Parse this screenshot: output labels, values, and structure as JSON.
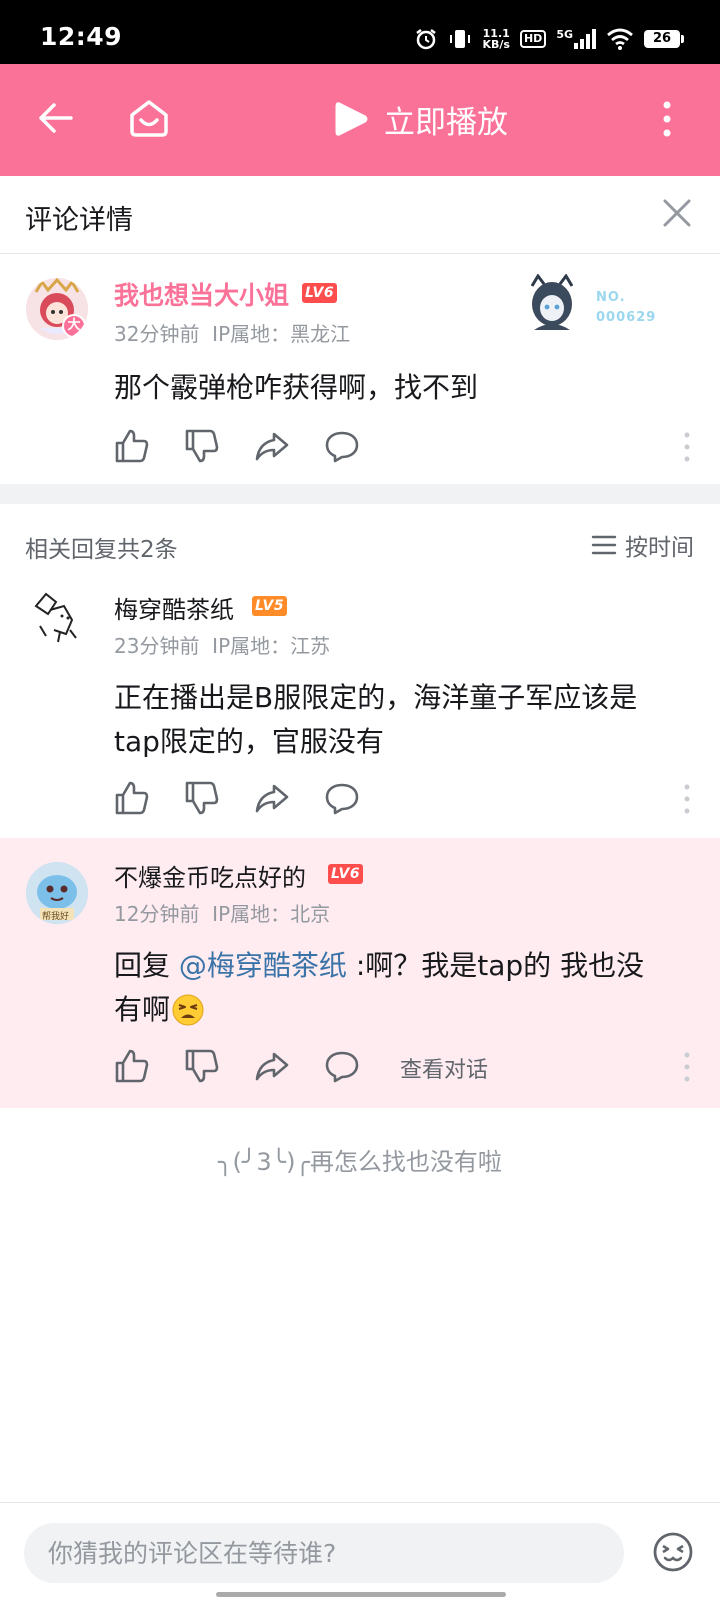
{
  "status_bar": {
    "time": "12:49",
    "net_speed_value": "11.1",
    "net_speed_unit": "KB/s",
    "hd": "HD",
    "signal": "5G",
    "battery": "26"
  },
  "header": {
    "play_now_label": "立即播放"
  },
  "title_row": {
    "title": "评论详情"
  },
  "main_comment": {
    "username": "我也想当大小姐",
    "level": "LV6",
    "time": "32分钟前",
    "ip_label": "IP属地：",
    "ip_location": "黑龙江",
    "text": "那个霰弹枪咋获得啊，找不到",
    "badge_no_line1": "NO.",
    "badge_no_line2": "000629",
    "avatar_badge": "大"
  },
  "replies_header": {
    "count_label": "相关回复共2条",
    "sort_label": "按时间"
  },
  "replies": [
    {
      "username": "梅穿酷茶纸",
      "level": "LV5",
      "time": "23分钟前",
      "ip_label": "IP属地：",
      "ip_location": "江苏",
      "text_line1": "正在播出是B服限定的，海洋童子军应该是",
      "text_line2": "tap限定的，官服没有"
    },
    {
      "username": "不爆金币吃点好的",
      "level": "LV6",
      "time": "12分钟前",
      "ip_label": "IP属地：",
      "ip_location": "北京",
      "text_prefix": "回复 ",
      "mention": "@梅穿酷茶纸",
      "text_line1_rest": " :啊？我是tap的 我也没",
      "text_line2": "有啊",
      "view_conversation": "查看对话",
      "avatar_caption": "帮我好"
    }
  ],
  "end_text": "╮(╯3╰)╭再怎么找也没有啦",
  "bottom_bar": {
    "input_placeholder": "你猜我的评论区在等待谁?"
  },
  "colors": {
    "brand_pink": "#fb7299",
    "reply_highlight": "#ffecf1",
    "level6": "#fe4d4d",
    "level5": "#ff8c29",
    "mention": "#3a73a8",
    "muted_text": "#9499a0"
  }
}
